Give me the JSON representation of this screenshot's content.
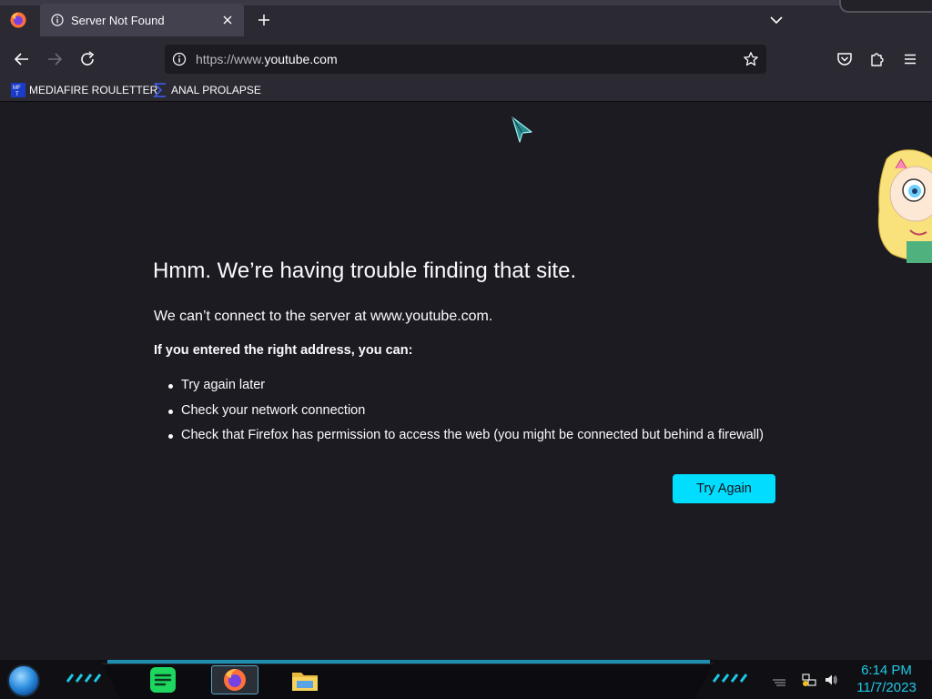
{
  "browser": {
    "tab": {
      "title": "Server Not Found"
    },
    "address": {
      "prefix": "https://www.",
      "domain": "youtube.com"
    },
    "bookmarks": [
      {
        "label": "MEDIAFIRE ROULETTER",
        "icon": "mediafire-icon"
      },
      {
        "label": "ANAL PROLAPSE",
        "icon": "sigma-icon"
      }
    ]
  },
  "error_page": {
    "title": "Hmm. We’re having trouble finding that site.",
    "subtitle": "We can’t connect to the server at www.youtube.com.",
    "lead": "If you entered the right address, you can:",
    "suggestions": [
      "Try again later",
      "Check your network connection",
      "Check that Firefox has permission to access the web (you might be connected but behind a firewall)"
    ],
    "try_again_label": "Try Again"
  },
  "taskbar": {
    "apps": [
      "spotify-icon",
      "firefox-icon",
      "file-explorer-icon"
    ],
    "clock": {
      "time": "6:14 PM",
      "date": "11/7/2023"
    }
  },
  "colors": {
    "page_bg": "#1c1b22",
    "toolbar_bg": "#2b2a33",
    "accent_button": "#00ddff",
    "clock": "#1ec9e6"
  }
}
